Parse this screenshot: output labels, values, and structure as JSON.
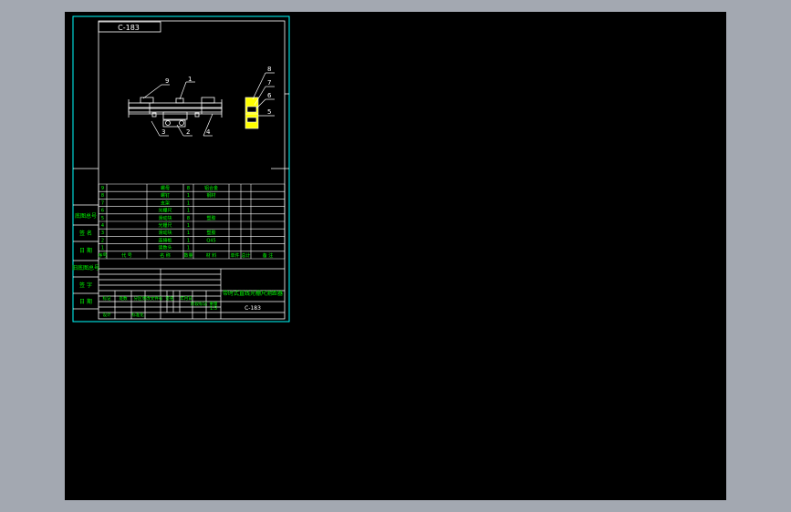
{
  "drawing_number": "C-183",
  "title_block_title": "带时式直线光栅尺测距器",
  "title_block_number": "C-183",
  "scale": "1:5",
  "balloons": [
    "9",
    "1",
    "2",
    "3",
    "4",
    "8",
    "7",
    "6",
    "5"
  ],
  "bom_rows": [
    {
      "no": "9",
      "name": "螺母",
      "qty": "8",
      "material": "铝合金"
    },
    {
      "no": "8",
      "name": "螺钉",
      "qty": "1",
      "material": "钢材"
    },
    {
      "no": "7",
      "name": "支架",
      "qty": "1",
      "material": ""
    },
    {
      "no": "6",
      "name": "光栅尺",
      "qty": "1",
      "material": ""
    },
    {
      "no": "5",
      "name": "滑动块",
      "qty": "8",
      "material": "塑胶"
    },
    {
      "no": "4",
      "name": "光栅尺",
      "qty": "1",
      "material": ""
    },
    {
      "no": "3",
      "name": "滑动块",
      "qty": "1",
      "material": "塑胶"
    },
    {
      "no": "2",
      "name": "连接板",
      "qty": "1",
      "material": "Q45"
    },
    {
      "no": "1",
      "name": "读数头",
      "qty": "1",
      "material": ""
    }
  ],
  "bom_header": {
    "no": "序号",
    "code": "代 号",
    "name": "名 称",
    "qty": "数量",
    "material": "材 料",
    "unit_wt": "单件",
    "total_wt": "总计",
    "remark": "备 注",
    "weight": "重量"
  },
  "side_labels": [
    "底图总号",
    "签 名",
    "日 期",
    "旧底图总号",
    "签 字",
    "日 期"
  ],
  "title_block_small": [
    "标记",
    "处数",
    "分区",
    "更改文件号",
    "签名",
    "年月日",
    "设计",
    "标准化",
    "审核",
    "工艺",
    "批准",
    "阶段标记",
    "重量",
    "比例",
    "共",
    "张",
    "第",
    "张"
  ],
  "colors": {
    "frame": "#00ffff",
    "draw": "#ffffff",
    "text": "#00ff00",
    "part": "#ffff00",
    "bg": "#000000",
    "outer": "#a3a8b1"
  }
}
